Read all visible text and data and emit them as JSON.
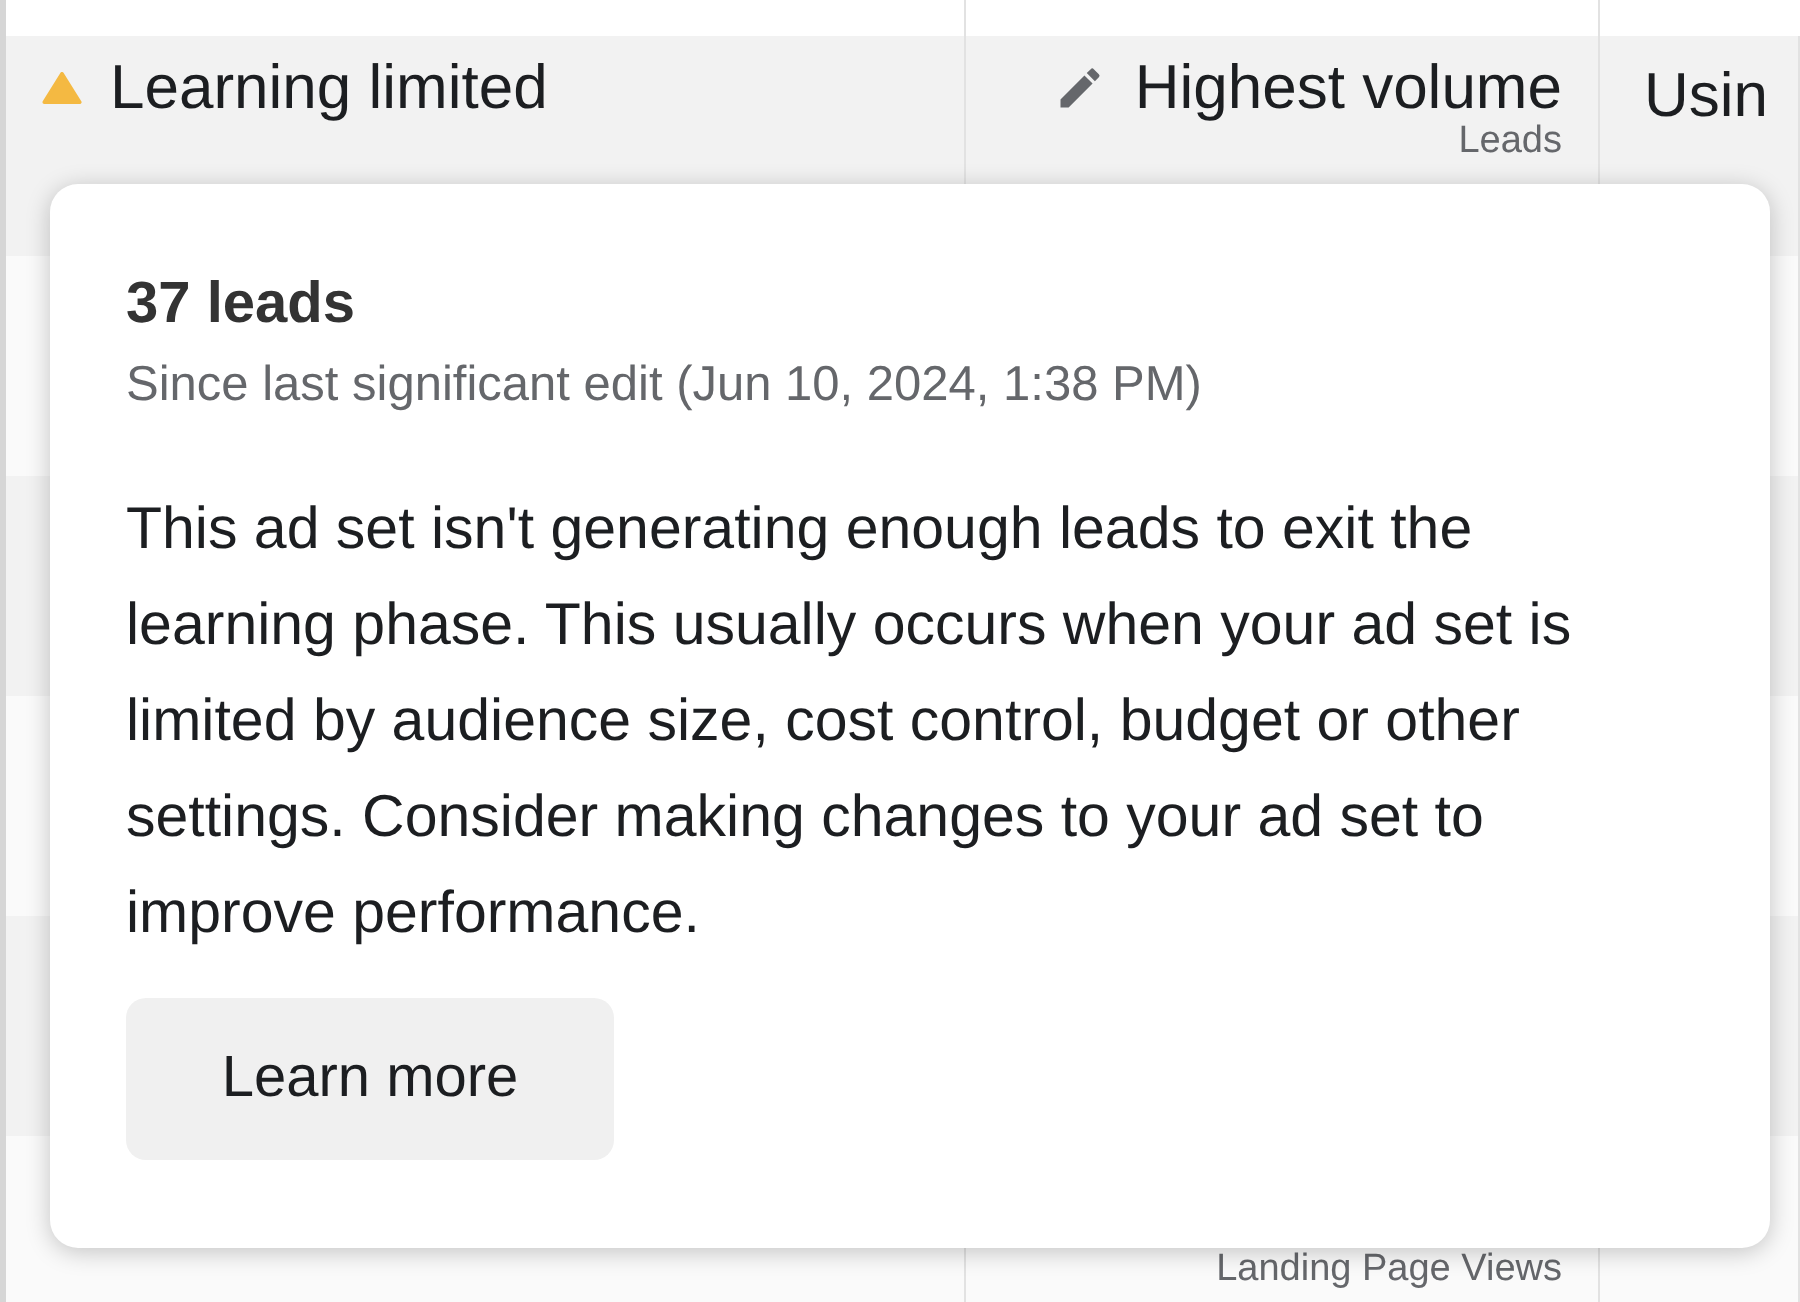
{
  "table": {
    "rows": [
      {
        "status": {
          "kind": "warning",
          "label": "Learning limited"
        },
        "goal": {
          "editable": true,
          "label": "Highest volume",
          "sub": "Leads"
        },
        "column_3": "Usin"
      },
      {},
      {},
      {},
      {},
      {
        "goal": {
          "sub": "Landing Page Views"
        }
      }
    ]
  },
  "tooltip": {
    "title": "37 leads",
    "subtitle": "Since last significant edit (Jun 10, 2024, 1:38 PM)",
    "body": "This ad set isn't generating enough leads to exit the learning phase. This usually occurs when your ad set is limited by audience size, cost control, budget or other settings. Consider making changes to your ad set to improve performance.",
    "button": "Learn more"
  }
}
